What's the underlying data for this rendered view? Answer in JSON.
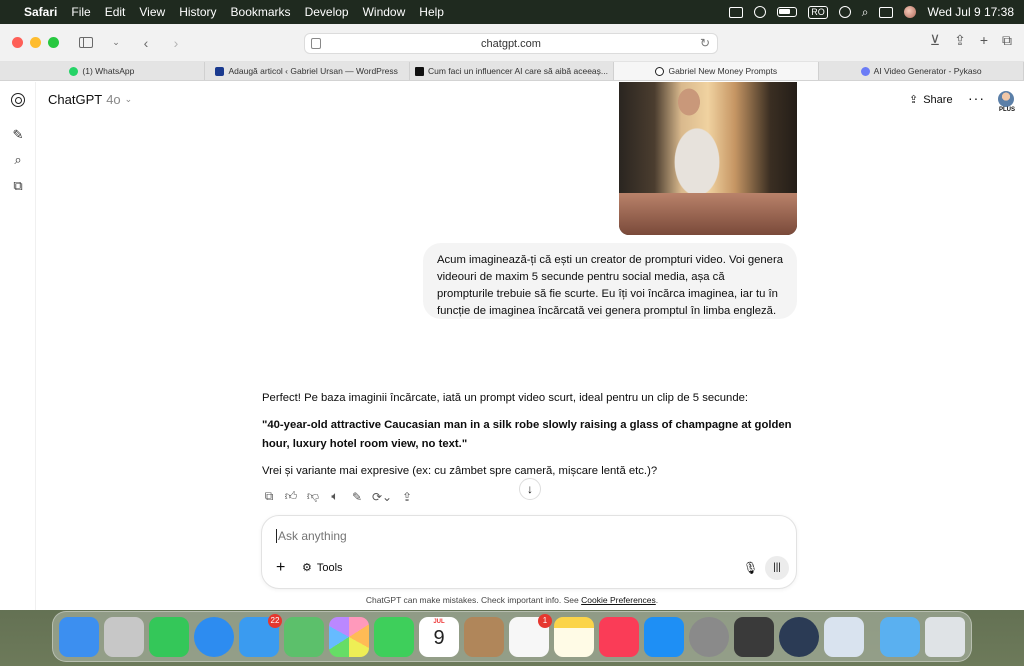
{
  "menubar": {
    "app": "Safari",
    "items": [
      "File",
      "Edit",
      "View",
      "History",
      "Bookmarks",
      "Develop",
      "Window",
      "Help"
    ],
    "input_source": "RO",
    "datetime": "Wed Jul 9  17:38"
  },
  "browser": {
    "url": "chatgpt.com",
    "tabs": [
      {
        "label": "(1) WhatsApp",
        "color": "#25d366"
      },
      {
        "label": "Adaugă articol ‹ Gabriel Ursan — WordPress",
        "color": "#1a3a8f"
      },
      {
        "label": "Cum faci un influencer AI care să aibă aceeaș...",
        "color": "#111111"
      },
      {
        "label": "Gabriel New Money Prompts",
        "color": "#222222"
      },
      {
        "label": "AI Video Generator - Pykaso",
        "color": "#6b7cf6"
      }
    ]
  },
  "chat": {
    "title": "ChatGPT",
    "model": "4o",
    "share_label": "Share",
    "plan_label": "PLUS",
    "user_message": "Acum imaginează-ți că ești un creator de prompturi video. Voi genera videouri de maxim 5 secunde pentru social media, așa că prompturile trebuie să fie scurte. Eu îți voi încărca imaginea, iar tu în funcție de imaginea încărcată vei genera promptul în limba engleză.",
    "assistant_intro": "Perfect! Pe baza imaginii încărcate, iată un prompt video scurt, ideal pentru un clip de 5 secunde:",
    "assistant_prompt": "\"40-year-old attractive Caucasian man in a silk robe slowly raising a glass of champagne at golden hour, luxury hotel room view, no text.\"",
    "assistant_followup": "Vrei și variante mai expresive (ex: cu zâmbet spre cameră, mișcare lentă etc.)?",
    "composer_placeholder": "Ask anything",
    "tools_label": "Tools",
    "disclaimer": "ChatGPT can make mistakes. Check important info. See ",
    "disclaimer_link": "Cookie Preferences",
    "disclaimer_end": "."
  },
  "dock": {
    "apps": [
      {
        "name": "finder",
        "color": "#3c8ff0"
      },
      {
        "name": "launchpad",
        "color": "#c7c7c7"
      },
      {
        "name": "messages",
        "color": "#34c759"
      },
      {
        "name": "safari",
        "color": "#2d8cf0"
      },
      {
        "name": "mail",
        "color": "#3a9bf0",
        "badge": "22"
      },
      {
        "name": "maps",
        "color": "#5cc06b"
      },
      {
        "name": "photos",
        "color": "#f4f4f4"
      },
      {
        "name": "facetime",
        "color": "#3ecf5b"
      },
      {
        "name": "calendar",
        "color": "#ffffff",
        "month": "JUL",
        "day": "9"
      },
      {
        "name": "contacts",
        "color": "#b0865a"
      },
      {
        "name": "reminders",
        "color": "#f7f7f7",
        "badge": "1"
      },
      {
        "name": "notes",
        "color": "#fbd44a"
      },
      {
        "name": "music",
        "color": "#fa3c57"
      },
      {
        "name": "app-store",
        "color": "#1e8ff5"
      },
      {
        "name": "system-settings",
        "color": "#8a8a8a"
      },
      {
        "name": "calculator",
        "color": "#3a3a3a"
      },
      {
        "name": "quicktime",
        "color": "#2b3b55"
      },
      {
        "name": "preview",
        "color": "#d9e3ef"
      },
      {
        "name": "downloads-folder",
        "color": "#5ab0f0"
      },
      {
        "name": "trash",
        "color": "#dfe3e6"
      }
    ]
  }
}
